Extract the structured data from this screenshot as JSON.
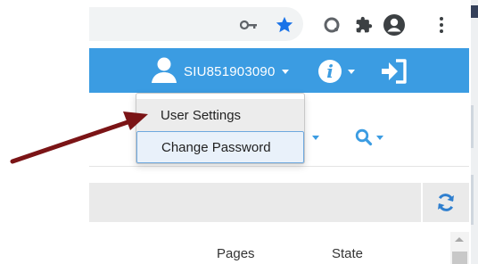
{
  "browser_toolbar": {
    "icons": [
      "key-icon",
      "bookmark-star-icon",
      "extension-icon",
      "puzzle-extensions-icon",
      "profile-icon",
      "more-menu-icon"
    ],
    "bookmark_star_color": "#1a73e8"
  },
  "navbar": {
    "background_color": "#3b9ce2",
    "user": {
      "username": "SIU851903090"
    },
    "icons": [
      "user-icon",
      "info-icon",
      "logout-icon"
    ],
    "info_symbol": "i"
  },
  "user_dropdown": {
    "items": [
      {
        "label": "User Settings",
        "highlighted": true
      },
      {
        "label": "Change Password",
        "focused": true
      }
    ]
  },
  "toolbar": {
    "icons": [
      "search-icon",
      "refresh-icon"
    ]
  },
  "table": {
    "columns": [
      {
        "label": "Pages"
      },
      {
        "label": "State"
      }
    ]
  },
  "annotation": {
    "arrow_color": "#7b1416",
    "points_to": "User Settings"
  }
}
